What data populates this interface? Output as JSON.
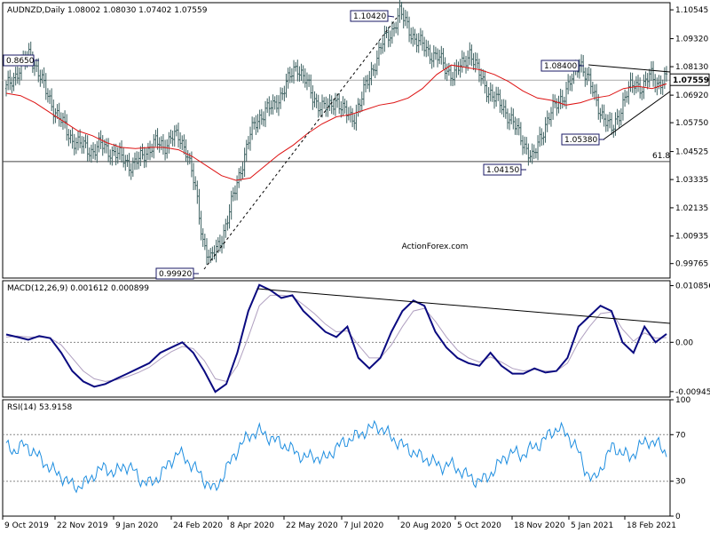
{
  "chart_data": {
    "type": "line",
    "panels": [
      {
        "id": "price",
        "header": "AUDNZD,Daily  1.08002 1.08030 1.07402 1.07559",
        "watermark": "ActionForex.com",
        "y_ticks": [
          "1.10545",
          "1.09320",
          "1.08130",
          "1.06920",
          "1.05750",
          "1.04525",
          "1.03335",
          "1.02135",
          "1.00935",
          "0.99765"
        ],
        "y_tick_values": [
          1.10545,
          1.0932,
          1.0813,
          1.0692,
          1.0575,
          1.04525,
          1.03335,
          1.02135,
          1.00935,
          0.99765
        ],
        "ylim": [
          0.9915,
          1.1085
        ],
        "current_value_label": "1.07559",
        "current_value": 1.07559,
        "close_series": [
          1.072,
          1.077,
          1.082,
          1.0865,
          1.08,
          1.071,
          1.064,
          1.058,
          1.052,
          1.049,
          1.047,
          1.0455,
          1.048,
          1.046,
          1.044,
          1.042,
          1.039,
          1.042,
          1.046,
          1.049,
          1.047,
          1.052,
          1.0505,
          1.046,
          1.03,
          1.008,
          0.9992,
          1.005,
          1.015,
          1.027,
          1.04,
          1.052,
          1.059,
          1.063,
          1.064,
          1.07,
          1.076,
          1.082,
          1.076,
          1.068,
          1.065,
          1.063,
          1.068,
          1.062,
          1.059,
          1.066,
          1.075,
          1.084,
          1.092,
          1.096,
          1.1042,
          1.099,
          1.093,
          1.09,
          1.087,
          1.085,
          1.08,
          1.078,
          1.082,
          1.088,
          1.079,
          1.073,
          1.068,
          1.065,
          1.06,
          1.054,
          1.048,
          1.0415,
          1.052,
          1.06,
          1.065,
          1.07,
          1.076,
          1.084,
          1.076,
          1.067,
          1.06,
          1.0538,
          1.062,
          1.07,
          1.075,
          1.072,
          1.078,
          1.074,
          1.0756
        ],
        "ma_series": [
          1.07,
          1.069,
          1.066,
          1.062,
          1.058,
          1.054,
          1.052,
          1.049,
          1.047,
          1.0465,
          1.047,
          1.047,
          1.046,
          1.043,
          1.039,
          1.035,
          1.033,
          1.034,
          1.039,
          1.044,
          1.048,
          1.053,
          1.057,
          1.06,
          1.061,
          1.063,
          1.065,
          1.066,
          1.068,
          1.072,
          1.078,
          1.082,
          1.081,
          1.08,
          1.078,
          1.075,
          1.071,
          1.068,
          1.067,
          1.065,
          1.066,
          1.068,
          1.069,
          1.072,
          1.073,
          1.072,
          1.074
        ],
        "hlines": [
          {
            "label": "61.8",
            "value": 1.041
          }
        ],
        "callouts": [
          "1.10420",
          "0.8650",
          "1.08400",
          "1.05380",
          "1.04150",
          "0.99920"
        ]
      },
      {
        "id": "macd",
        "header": "MACD(12,26,9) 0.001612 0.000899",
        "y_ticks": [
          "0.010856",
          "0.00",
          "-0.009454"
        ],
        "y_tick_values": [
          0.010856,
          0.0,
          -0.009454
        ],
        "ylim": [
          -0.0105,
          0.0118
        ],
        "macd_series": [
          0.0015,
          0.001,
          0.0005,
          0.0012,
          0.0008,
          -0.002,
          -0.0055,
          -0.0075,
          -0.0085,
          -0.008,
          -0.007,
          -0.006,
          -0.005,
          -0.004,
          -0.002,
          -0.001,
          0.0,
          -0.002,
          -0.0055,
          -0.0095,
          -0.008,
          -0.002,
          0.006,
          0.011,
          0.01,
          0.0085,
          0.009,
          0.006,
          0.004,
          0.002,
          0.001,
          0.003,
          -0.003,
          -0.005,
          -0.003,
          0.002,
          0.006,
          0.008,
          0.007,
          0.002,
          -0.001,
          -0.003,
          -0.004,
          -0.0045,
          -0.002,
          -0.0045,
          -0.006,
          -0.006,
          -0.005,
          -0.0058,
          -0.0055,
          -0.003,
          0.003,
          0.005,
          0.007,
          0.006,
          0.0,
          -0.002,
          0.003,
          0.0,
          0.0016
        ],
        "signal_series": [
          0.001,
          0.0012,
          0.001,
          0.001,
          0.0008,
          -0.0005,
          -0.003,
          -0.0055,
          -0.007,
          -0.0075,
          -0.0072,
          -0.0066,
          -0.0058,
          -0.0048,
          -0.0032,
          -0.0018,
          -0.0008,
          -0.0012,
          -0.0035,
          -0.007,
          -0.0075,
          -0.0045,
          0.001,
          0.007,
          0.009,
          0.009,
          0.0088,
          0.0072,
          0.0055,
          0.0035,
          0.002,
          0.0022,
          -0.0005,
          -0.003,
          -0.003,
          -0.0005,
          0.003,
          0.006,
          0.0065,
          0.004,
          0.001,
          -0.0015,
          -0.003,
          -0.0038,
          -0.0028,
          -0.0038,
          -0.005,
          -0.0055,
          -0.0052,
          -0.0055,
          -0.0055,
          -0.004,
          0.0,
          0.003,
          0.0055,
          0.0058,
          0.0025,
          0.0002,
          0.0018,
          0.0008,
          0.0009
        ]
      },
      {
        "id": "rsi",
        "header": "RSI(14) 53.9158",
        "y_ticks": [
          "100",
          "70",
          "30",
          "0"
        ],
        "y_tick_values": [
          100,
          70,
          30,
          0
        ],
        "ylim": [
          0,
          100
        ],
        "levels": [
          70,
          30
        ],
        "rsi_series": [
          60,
          56,
          62,
          55,
          48,
          40,
          35,
          28,
          25,
          30,
          38,
          42,
          36,
          44,
          40,
          30,
          28,
          35,
          45,
          55,
          48,
          40,
          30,
          22,
          35,
          50,
          62,
          70,
          73,
          68,
          64,
          60,
          55,
          50,
          52,
          48,
          55,
          62,
          66,
          70,
          74,
          78,
          72,
          65,
          60,
          55,
          50,
          48,
          42,
          45,
          40,
          35,
          30,
          32,
          40,
          50,
          55,
          52,
          58,
          62,
          70,
          76,
          70,
          60,
          40,
          30,
          45,
          60,
          55,
          50,
          60,
          65,
          62,
          54
        ],
        "x_ticks": [
          "9 Oct 2019",
          "22 Nov 2019",
          "9 Jan 2020",
          "24 Feb 2020",
          "8 Apr 2020",
          "22 May 2020",
          "7 Jul 2020",
          "20 Aug 2020",
          "5 Oct 2020",
          "18 Nov 2020",
          "5 Jan 2021",
          "18 Feb 2021"
        ]
      }
    ]
  },
  "colors": {
    "bars": "#3d6161",
    "ma": "#dd1111",
    "macd": "#0a0a80",
    "signal": "#b0a0c0",
    "rsi": "#1e8ee0",
    "trendline": "#000000",
    "level": "#888888",
    "grid_border": "#000000",
    "watermark": "#c8c8c8"
  }
}
